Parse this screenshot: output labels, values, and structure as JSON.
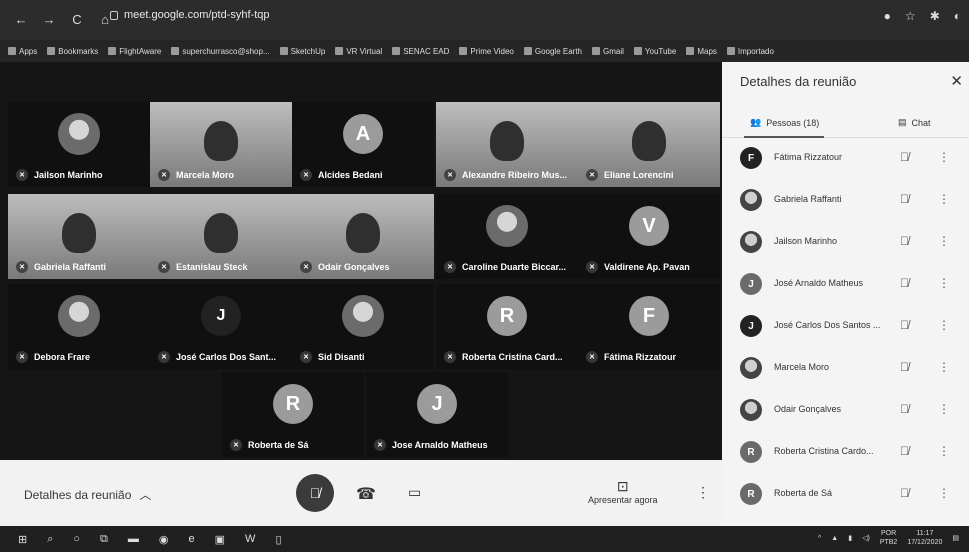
{
  "browser": {
    "url": "meet.google.com/ptd-syhf-tqp",
    "bookmarks": [
      "Apps",
      "Bookmarks",
      "FlightAware",
      "superchurrasco@shop...",
      "SketchUp",
      "VR Virtual",
      "SENAC EAD",
      "Prime Video",
      "Google Earth",
      "Gmail",
      "YouTube",
      "Maps",
      "Importado"
    ]
  },
  "tiles": [
    {
      "name": "Jailson Marinho",
      "type": "avatar-photo"
    },
    {
      "name": "Marcela Moro",
      "type": "photo"
    },
    {
      "name": "Alcides Bedani",
      "type": "letter",
      "letter": "A"
    },
    {
      "name": "Alexandre Ribeiro Mus...",
      "type": "photo"
    },
    {
      "name": "Eliane Lorencini",
      "type": "photo"
    },
    {
      "name": "Gabriela Raffanti",
      "type": "photo"
    },
    {
      "name": "Estanislau Steck",
      "type": "photo"
    },
    {
      "name": "Odair Gonçalves",
      "type": "photo"
    },
    {
      "name": "Caroline Duarte Biccar...",
      "type": "avatar-photo"
    },
    {
      "name": "Valdirene Ap. Pavan",
      "type": "letter",
      "letter": "V"
    },
    {
      "name": "Debora Frare",
      "type": "avatar-photo"
    },
    {
      "name": "José Carlos Dos Sant...",
      "type": "letter-dark",
      "letter": "J"
    },
    {
      "name": "Sid Disanti",
      "type": "avatar-photo"
    },
    {
      "name": "Roberta Cristina Card...",
      "type": "letter",
      "letter": "R"
    },
    {
      "name": "Fátima Rizzatour",
      "type": "letter",
      "letter": "F"
    },
    {
      "name": "Roberta de Sá",
      "type": "letter",
      "letter": "R"
    },
    {
      "name": "Jose Arnaldo Matheus",
      "type": "letter",
      "letter": "J"
    }
  ],
  "bottombar": {
    "details_label": "Detalhes da reunião",
    "present_label": "Apresentar agora"
  },
  "panel": {
    "title": "Detalhes da reunião",
    "tab_people": "Pessoas (18)",
    "tab_chat": "Chat",
    "people": [
      {
        "name": "Fátima Rizzatour",
        "avatar": "F",
        "style": "dark"
      },
      {
        "name": "Gabriela Raffanti",
        "avatar": "",
        "style": "photo"
      },
      {
        "name": "Jailson Marinho",
        "avatar": "",
        "style": "photo"
      },
      {
        "name": "José Arnaldo Matheus",
        "avatar": "J",
        "style": "grey"
      },
      {
        "name": "José Carlos Dos Santos ...",
        "avatar": "J",
        "style": "dark"
      },
      {
        "name": "Marcela Moro",
        "avatar": "",
        "style": "photo"
      },
      {
        "name": "Odair Gonçalves",
        "avatar": "",
        "style": "photo"
      },
      {
        "name": "Roberta Cristina Cardo...",
        "avatar": "R",
        "style": "grey"
      },
      {
        "name": "Roberta de Sá",
        "avatar": "R",
        "style": "grey"
      }
    ]
  },
  "taskbar": {
    "lang": "POR",
    "lang2": "PTB2",
    "time": "11:17",
    "date": "17/12/2020"
  }
}
